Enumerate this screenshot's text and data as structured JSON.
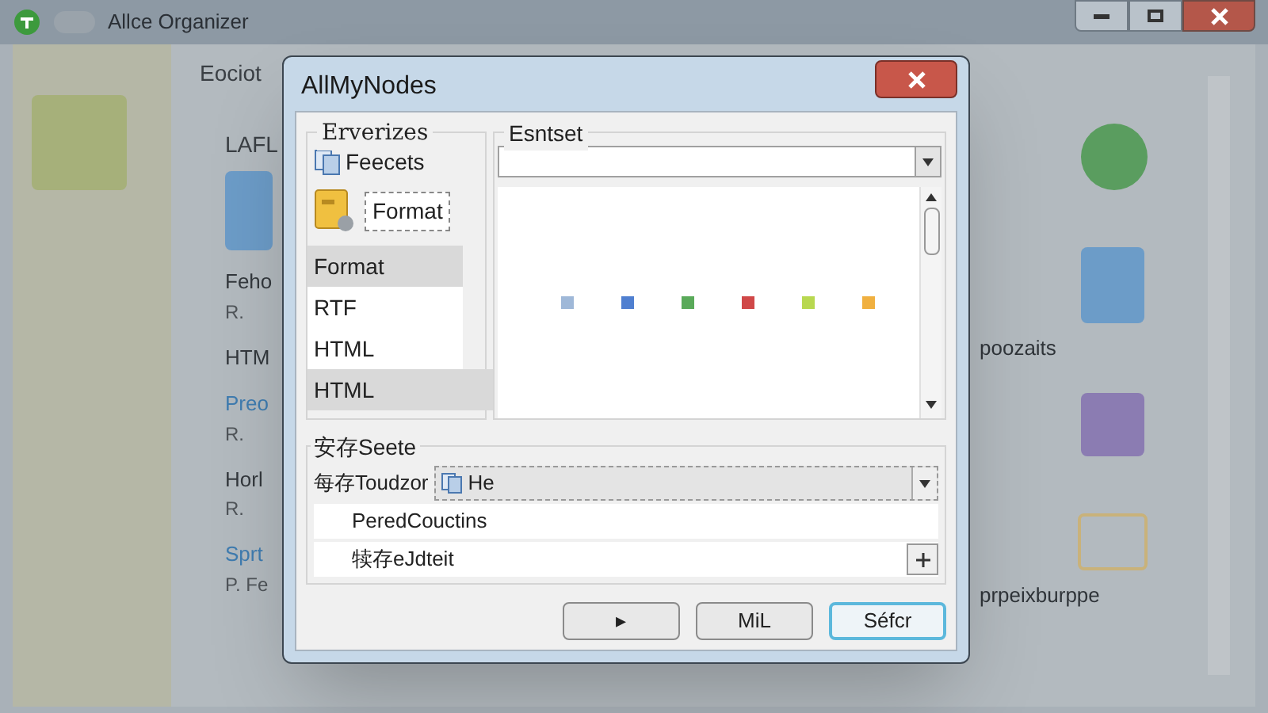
{
  "app": {
    "title": "Allce Organizer",
    "header": "Eociot",
    "panel_title": "LAFL",
    "items": [
      {
        "title": "Feho",
        "subtitle": "R.",
        "link": false
      },
      {
        "title": "HTM",
        "link": false
      },
      {
        "title": "Preo",
        "subtitle": "R.",
        "link": true
      },
      {
        "title": "Horl",
        "subtitle": "R.",
        "link": false
      },
      {
        "title": "Sprt",
        "subtitle": "P. Fe",
        "link": true
      }
    ],
    "right_captions": [
      "poozaits",
      "prpeixburppe"
    ]
  },
  "dialog": {
    "title": "AllMyNodes",
    "left_group": {
      "label": "Erverizes",
      "header": "Feecets",
      "format_label": "Format",
      "items": [
        {
          "label": "Format",
          "highlighted": true
        },
        {
          "label": "RTF",
          "highlighted": false
        },
        {
          "label": "HTML",
          "highlighted": false
        },
        {
          "label": "HTML",
          "highlighted": true
        }
      ]
    },
    "right_group": {
      "label": "Esntset",
      "swatches": [
        {
          "color": "#9fb8d8"
        },
        {
          "color": "#4f7fd0"
        },
        {
          "color": "#5aaa5a"
        },
        {
          "color": "#d04848"
        },
        {
          "color": "#b8d850"
        },
        {
          "color": "#f0b040"
        }
      ]
    },
    "bottom_group": {
      "label": "安存Seete",
      "field_label": "每存Toudzor",
      "field_value": "He",
      "rows": [
        "PeredCouctins",
        "犊存eJdteit"
      ]
    },
    "buttons": [
      {
        "label": "▸",
        "focused": false
      },
      {
        "label": "MiL",
        "focused": false
      },
      {
        "label": "Séfcr",
        "focused": true
      }
    ]
  }
}
